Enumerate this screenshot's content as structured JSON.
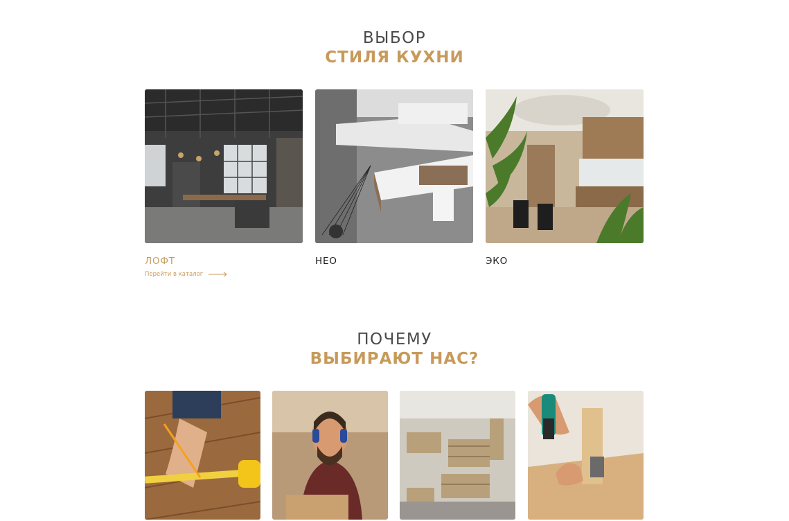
{
  "styles_section": {
    "title_line1": "ВЫБОР",
    "title_line2": "СТИЛЯ КУХНИ",
    "cards": [
      {
        "label": "ЛОФТ",
        "link": "Перейти в каталог"
      },
      {
        "label": "НЕО"
      },
      {
        "label": "ЭКО"
      }
    ]
  },
  "why_section": {
    "title_line1": "ПОЧЕМУ",
    "title_line2": "ВЫБИРАЮТ НАС?"
  },
  "colors": {
    "accent": "#c89a5a",
    "text_dark": "#1a1a1a",
    "background": "#ffffff"
  }
}
